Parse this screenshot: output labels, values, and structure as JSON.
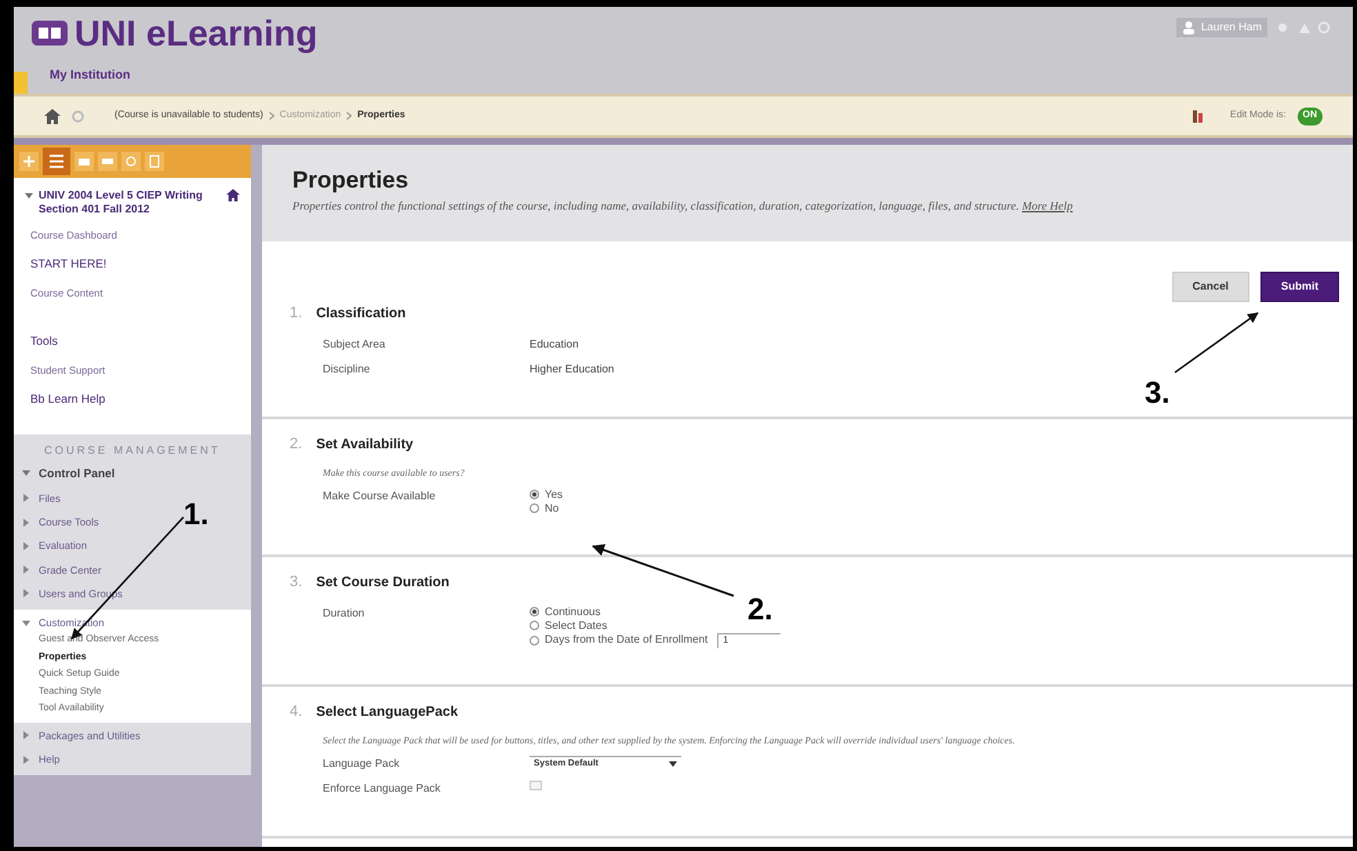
{
  "header": {
    "logo_text": "UNI eLearning",
    "tab": "My Institution",
    "user_name": "Lauren Ham",
    "edit_mode_label": "Edit Mode is:",
    "edit_mode": {
      "label": "ON",
      "on": true
    }
  },
  "breadcrumbs": [
    "(Course is unavailable to students)",
    "Customization",
    "Properties"
  ],
  "sidebar": {
    "course_title": "UNIV 2004 Level 5 CIEP Writing Section 401 Fall 2012",
    "course_menu": [
      {
        "label": "Course Dashboard",
        "kind": "link"
      },
      {
        "label": "START HERE!",
        "kind": "heading"
      },
      {
        "label": "Course Content",
        "kind": "link"
      },
      {
        "kind": "gap"
      },
      {
        "label": "Tools",
        "kind": "heading"
      },
      {
        "label": "Student Support",
        "kind": "link"
      },
      {
        "label": "Bb Learn Help",
        "kind": "heading"
      }
    ],
    "management_title": "COURSE MANAGEMENT",
    "control_panel": {
      "label": "Control Panel",
      "expanded": true,
      "children": [
        {
          "label": "Files",
          "expanded": false
        },
        {
          "label": "Course Tools",
          "expanded": false
        },
        {
          "label": "Evaluation",
          "expanded": false
        },
        {
          "label": "Grade Center",
          "expanded": false
        },
        {
          "label": "Users and Groups",
          "expanded": false
        },
        {
          "label": "Customization",
          "expanded": true,
          "children": [
            {
              "label": "Guest and Observer Access",
              "selected": false
            },
            {
              "label": "Properties",
              "selected": true
            },
            {
              "label": "Quick Setup Guide",
              "selected": false
            },
            {
              "label": "Teaching Style",
              "selected": false
            },
            {
              "label": "Tool Availability",
              "selected": false
            }
          ]
        },
        {
          "label": "Packages and Utilities",
          "expanded": false
        },
        {
          "label": "Help",
          "expanded": false
        }
      ]
    }
  },
  "page": {
    "title": "Properties",
    "description": "Properties control the functional settings of the course, including name, availability, classification, duration, categorization, language, files, and structure.",
    "help_link": "More Help",
    "buttons": [
      {
        "label": "Cancel",
        "kind": "secondary"
      },
      {
        "label": "Submit",
        "kind": "primary"
      }
    ],
    "sections": [
      {
        "number": "1.",
        "title": "Classification",
        "rows": [
          {
            "kind": "value",
            "label": "Subject Area",
            "value": "Education"
          },
          {
            "kind": "value",
            "label": "Discipline",
            "value": "Higher Education"
          }
        ]
      },
      {
        "number": "2.",
        "title": "Set Availability",
        "instructions": "Make this course available to users?",
        "rows": [
          {
            "kind": "radio",
            "label": "Make Course Available",
            "options": [
              {
                "label": "Yes",
                "selected": true
              },
              {
                "label": "No",
                "selected": false
              }
            ]
          }
        ]
      },
      {
        "number": "3.",
        "title": "Set Course Duration",
        "rows": [
          {
            "kind": "radio",
            "label": "Duration",
            "options": [
              {
                "label": "Continuous",
                "selected": true
              },
              {
                "label": "Select Dates",
                "selected": false
              },
              {
                "label": "Days from the Date of Enrollment",
                "selected": false,
                "input": "1"
              }
            ]
          }
        ]
      },
      {
        "number": "4.",
        "title": "Select LanguagePack",
        "instructions": "Select the Language Pack that will be used for buttons, titles, and other text supplied by the system. Enforcing the Language Pack will override individual users' language choices.",
        "rows": [
          {
            "kind": "select",
            "label": "Language Pack",
            "value": "System Default"
          },
          {
            "kind": "checkbox",
            "label": "Enforce Language Pack",
            "checked": false
          }
        ]
      }
    ]
  },
  "annotations": [
    "1.",
    "2.",
    "3."
  ]
}
